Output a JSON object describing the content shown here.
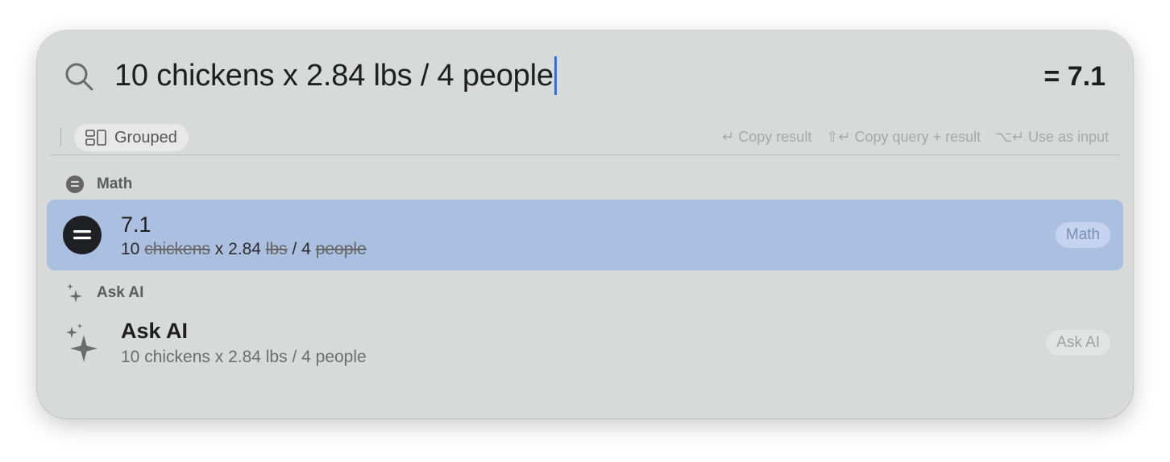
{
  "search": {
    "query": "10 chickens x 2.84 lbs / 4 people",
    "result": "= 7.1"
  },
  "toolbar": {
    "grouped_label": "Grouped",
    "shortcuts": [
      {
        "keys": "↵",
        "label": "Copy result"
      },
      {
        "keys": "⇧↵",
        "label": "Copy query + result"
      },
      {
        "keys": "⌥↵",
        "label": "Use as input"
      }
    ]
  },
  "sections": {
    "math": {
      "header": "Math",
      "item": {
        "title": "7.1",
        "sub": [
          {
            "text": "10 ",
            "struck": false
          },
          {
            "text": "chickens",
            "struck": true
          },
          {
            "text": " x 2.84 ",
            "struck": false
          },
          {
            "text": "lbs",
            "struck": true
          },
          {
            "text": " / 4 ",
            "struck": false
          },
          {
            "text": "people",
            "struck": true
          }
        ],
        "tag": "Math"
      }
    },
    "ai": {
      "header": "Ask AI",
      "item": {
        "title": "Ask AI",
        "sub": "10 chickens x 2.84 lbs / 4 people",
        "tag": "Ask AI"
      }
    }
  },
  "colors": {
    "selection": "#abbfe0",
    "caret": "#2f6fe6"
  }
}
